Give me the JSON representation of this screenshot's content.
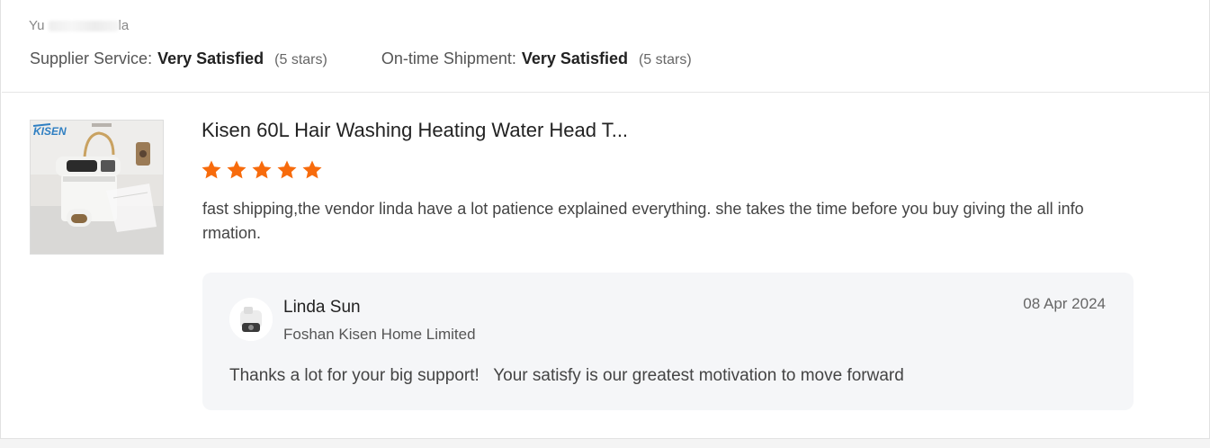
{
  "reviewer": {
    "name_visible": "Yu",
    "name_tail": "la"
  },
  "ratings": {
    "supplier_service": {
      "label": "Supplier Service:",
      "value": "Very Satisfied",
      "count": "(5 stars)"
    },
    "on_time_shipment": {
      "label": "On-time Shipment:",
      "value": "Very Satisfied",
      "count": "(5 stars)"
    }
  },
  "product": {
    "thumbnail_brand": "KISEN",
    "title": "Kisen 60L Hair Washing Heating Water Head T...",
    "rating": 5,
    "rating_max": 5,
    "star_color": "#f76b0c",
    "review": "fast shipping,the vendor linda have a lot patience explained everything. she takes the time before you buy giving the all  information."
  },
  "reply": {
    "name": "Linda Sun",
    "company": "Foshan Kisen Home Limited",
    "date": "08 Apr 2024",
    "text": "Thanks a lot for your big support!   Your satisfy is our greatest motivation to move forward"
  }
}
